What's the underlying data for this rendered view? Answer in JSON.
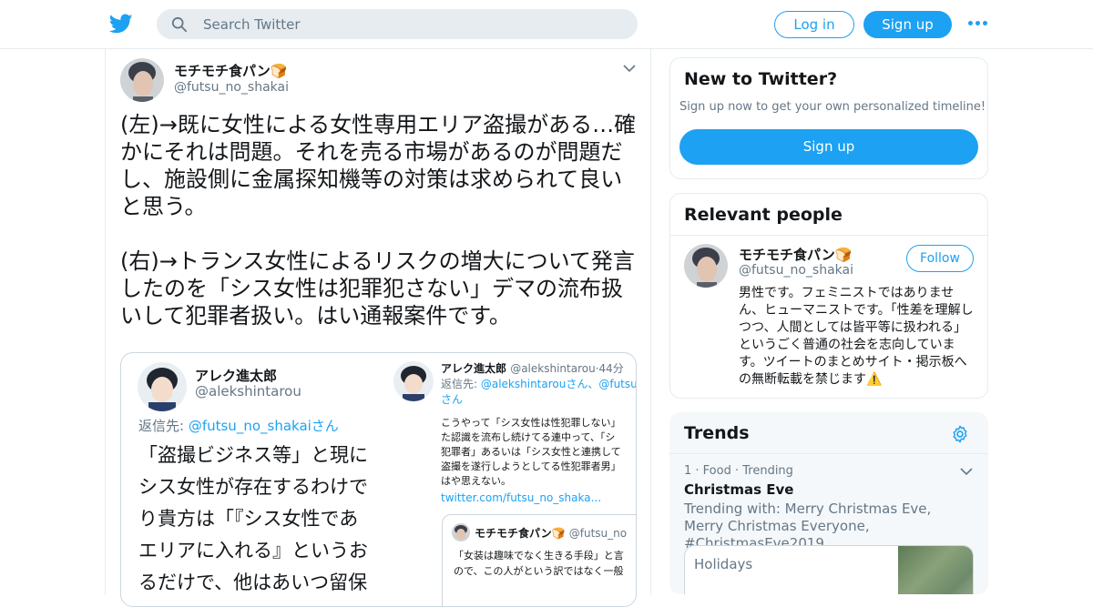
{
  "header": {
    "search_placeholder": "Search Twitter",
    "login_label": "Log in",
    "signup_label": "Sign up",
    "brand_color": "#1da1f2"
  },
  "tweet": {
    "author_name": "モチモチ食パン🍞",
    "author_handle": "@futsu_no_shakai",
    "text": "(左)→既に女性による女性専用エリア盗撮がある…確かにそれは問題。それを売る市場があるのが問題だし、施設側に金属探知機等の対策は求められて良いと思う。\n\n(右)→トランス女性によるリスクの増大について発言したのを「シス女性は犯罪犯さない」デマの流布扱いして犯罪者扱い。はい通報案件です。",
    "embed": {
      "left": {
        "name": "アレク進太郎",
        "handle": "@alekshintarou",
        "reply_prefix": "返信先: ",
        "reply_to": "@futsu_no_shakaiさん",
        "text": "「盗撮ビジネス等」と現に\nシス女性が存在するわけで\nり貴方は「『シス女性であ\nエリアに入れる』というお\nるだけで、他はあいつ留保"
      },
      "right": {
        "name": "アレク進太郎",
        "handle_time": "@alekshintarou·44分",
        "reply_prefix": "返信先: ",
        "reply_to_1": "@alekshintarouさん、@futsu",
        "reply_to_2": "さん",
        "text": "こうやって「シス女性は性犯罪しない」\nた認識を流布し続けてる連中って、「シ\n犯罪者」あるいは「シス女性と連携して\n盗撮を遂行しようとしてる性犯罪者男」\nはや思えない。",
        "link": "twitter.com/futsu_no_shaka...",
        "quote": {
          "name": "モチモチ食パン🍞",
          "handle": "@futsu_no",
          "text": "「女装は趣味でなく生きる手段」と言\nので、この人がという訳ではなく一般"
        }
      }
    }
  },
  "sidebar": {
    "new_to_twitter": {
      "title": "New to Twitter?",
      "subtitle": "Sign up now to get your own personalized timeline!",
      "button": "Sign up"
    },
    "relevant_people": {
      "title": "Relevant people",
      "name": "モチモチ食パン🍞",
      "handle": "@futsu_no_shakai",
      "follow_label": "Follow",
      "bio": "男性です。フェミニストではありません、ヒューマニストです。「性差を理解しつつ、人間としては皆平等に扱われる」というごく普通の社会を志向しています。ツイートのまとめサイト・掲示板への無断転載を禁じます⚠️"
    },
    "trends": {
      "title": "Trends",
      "item_meta": "1 · Food · Trending",
      "item_title": "Christmas Eve",
      "item_with": "Trending with: Merry Christmas Eve, Merry Christmas Everyone, #ChristmasEve2019",
      "card_label": "Holidays"
    }
  }
}
